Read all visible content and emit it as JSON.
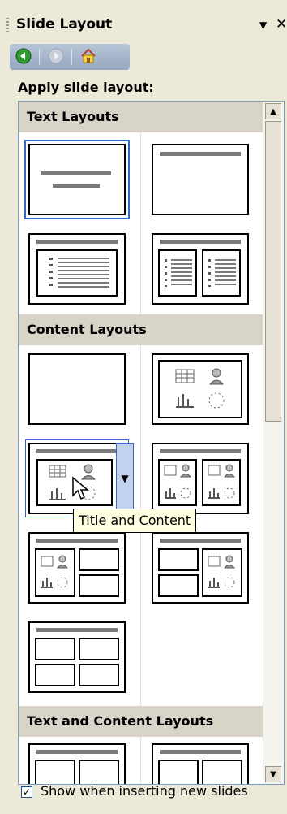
{
  "pane": {
    "title": "Slide Layout",
    "apply_label": "Apply slide layout:"
  },
  "sections": [
    {
      "title": "Text Layouts"
    },
    {
      "title": "Content Layouts"
    },
    {
      "title": "Text and Content Layouts"
    }
  ],
  "tooltip": {
    "text": "Title and Content"
  },
  "footer": {
    "checkbox_label": "Show when inserting new slides",
    "checked": true
  },
  "icons": {
    "back": "back-arrow-icon",
    "forward": "forward-arrow-icon",
    "home": "home-icon",
    "dropdown": "dropdown-arrow-icon",
    "close": "close-icon"
  }
}
